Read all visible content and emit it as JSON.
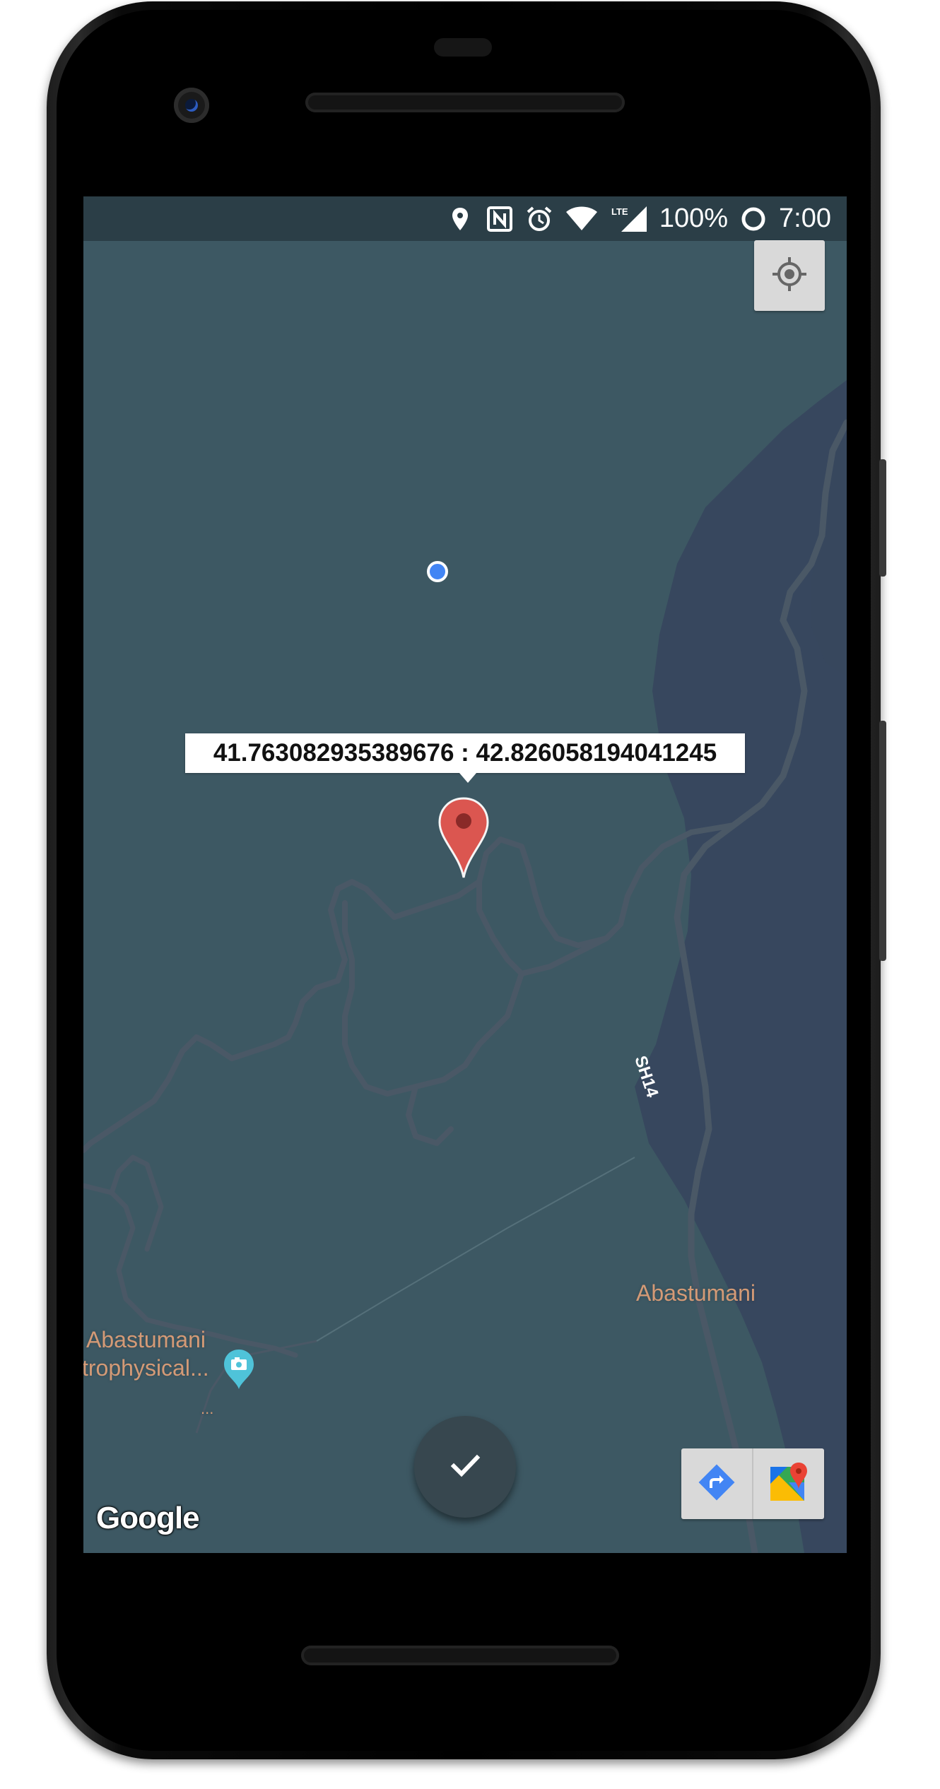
{
  "status_bar": {
    "battery": "100%",
    "time": "7:00",
    "network": "LTE",
    "icons": [
      "location-icon",
      "nfc-icon",
      "alarm-icon",
      "wifi-icon",
      "lte-signal-icon",
      "battery-icon"
    ]
  },
  "map": {
    "marker_info": "41.763082935389676 : 42.826058194041245",
    "road_label": "SH14",
    "place_labels": {
      "town": "Abastumani",
      "observatory_line1": "Abastumani",
      "observatory_line2": "trophysical...",
      "ellipsis": "..."
    },
    "attribution": "Google"
  },
  "controls": {
    "my_location_icon": "my-location-icon",
    "confirm_icon": "check-icon",
    "directions_icon": "directions-icon",
    "open_in_maps_icon": "google-maps-icon"
  },
  "colors": {
    "map_land": "#3d5863",
    "map_water": "#37475e",
    "road": "#4a5866",
    "place_label": "#d49a76",
    "marker": "#db4437",
    "fab": "#37474f",
    "user_dot": "#4285f4"
  }
}
